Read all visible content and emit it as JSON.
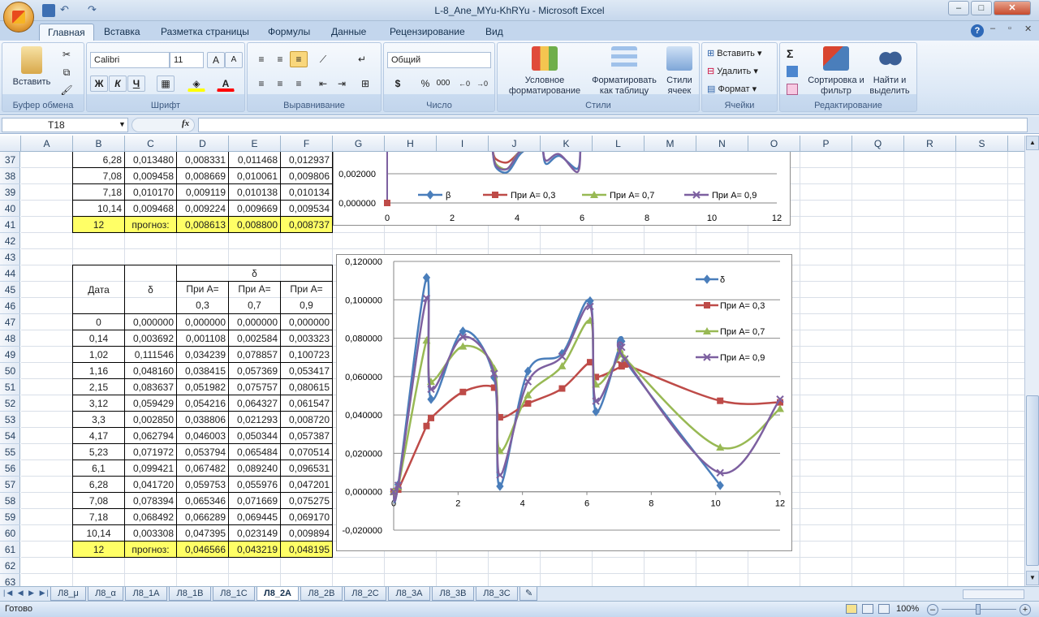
{
  "window": {
    "title": "L-8_Ane_MYu-KhRYu - Microsoft Excel"
  },
  "ribbon_tabs": [
    "Главная",
    "Вставка",
    "Разметка страницы",
    "Формулы",
    "Данные",
    "Рецензирование",
    "Вид"
  ],
  "ribbon": {
    "clipboard": {
      "paste": "Вставить",
      "label": "Буфер обмена"
    },
    "font": {
      "name": "Calibri",
      "size": "11",
      "label": "Шрифт",
      "bold": "Ж",
      "italic": "К",
      "underline": "Ч"
    },
    "alignment": {
      "label": "Выравнивание"
    },
    "number": {
      "format": "Общий",
      "label": "Число",
      "currency": "$",
      "percent": "%",
      "thousands": "000"
    },
    "styles": {
      "cond": "Условное форматирование",
      "table": "Форматировать как таблицу",
      "cell": "Стили ячеек",
      "label": "Стили"
    },
    "cells": {
      "insert": "Вставить",
      "delete": "Удалить",
      "format": "Формат",
      "label": "Ячейки"
    },
    "editing": {
      "sigma": "Σ",
      "sort": "Сортировка и фильтр",
      "find": "Найти и выделить",
      "label": "Редактирование"
    }
  },
  "formula_bar": {
    "name_box": "T18",
    "fx": "fx",
    "value": ""
  },
  "columns": [
    "A",
    "B",
    "C",
    "D",
    "E",
    "F",
    "G",
    "H",
    "I",
    "J",
    "K",
    "L",
    "M",
    "N",
    "O",
    "P",
    "Q",
    "R",
    "S"
  ],
  "rows": [
    "37",
    "38",
    "39",
    "40",
    "41",
    "42",
    "43",
    "44",
    "45",
    "46",
    "47",
    "48",
    "49",
    "50",
    "51",
    "52",
    "53",
    "54",
    "55",
    "56",
    "57",
    "58",
    "59",
    "60",
    "61",
    "62",
    "63"
  ],
  "top_table": [
    [
      "6,28",
      "0,013480",
      "0,008331",
      "0,011468",
      "0,012937"
    ],
    [
      "7,08",
      "0,009458",
      "0,008669",
      "0,010061",
      "0,009806"
    ],
    [
      "7,18",
      "0,010170",
      "0,009119",
      "0,010138",
      "0,010134"
    ],
    [
      "10,14",
      "0,009468",
      "0,009224",
      "0,009669",
      "0,009534"
    ]
  ],
  "top_forecast": [
    "12",
    "прогноз:",
    "0,008613",
    "0,008800",
    "0,008737"
  ],
  "table": {
    "h_date": "Дата",
    "h_delta": "δ",
    "h_group": "δ",
    "h_a1": "При А=",
    "h_a2": "При А=",
    "h_a3": "При А=",
    "h_v1": "0,3",
    "h_v2": "0,7",
    "h_v3": "0,9",
    "rows": [
      [
        "0",
        "0,000000",
        "0,000000",
        "0,000000",
        "0,000000"
      ],
      [
        "0,14",
        "0,003692",
        "0,001108",
        "0,002584",
        "0,003323"
      ],
      [
        "1,02",
        "0,111546",
        "0,034239",
        "0,078857",
        "0,100723"
      ],
      [
        "1,16",
        "0,048160",
        "0,038415",
        "0,057369",
        "0,053417"
      ],
      [
        "2,15",
        "0,083637",
        "0,051982",
        "0,075757",
        "0,080615"
      ],
      [
        "3,12",
        "0,059429",
        "0,054216",
        "0,064327",
        "0,061547"
      ],
      [
        "3,3",
        "0,002850",
        "0,038806",
        "0,021293",
        "0,008720"
      ],
      [
        "4,17",
        "0,062794",
        "0,046003",
        "0,050344",
        "0,057387"
      ],
      [
        "5,23",
        "0,071972",
        "0,053794",
        "0,065484",
        "0,070514"
      ],
      [
        "6,1",
        "0,099421",
        "0,067482",
        "0,089240",
        "0,096531"
      ],
      [
        "6,28",
        "0,041720",
        "0,059753",
        "0,055976",
        "0,047201"
      ],
      [
        "7,08",
        "0,078394",
        "0,065346",
        "0,071669",
        "0,075275"
      ],
      [
        "7,18",
        "0,068492",
        "0,066289",
        "0,069445",
        "0,069170"
      ],
      [
        "10,14",
        "0,003308",
        "0,047395",
        "0,023149",
        "0,009894"
      ]
    ],
    "forecast": [
      "12",
      "прогноз:",
      "0,046566",
      "0,043219",
      "0,048195"
    ]
  },
  "chart_data": [
    {
      "type": "line",
      "legend_position": "bottom",
      "x_ticks": [
        "0",
        "2",
        "4",
        "6",
        "8",
        "10",
        "12"
      ],
      "y_ticks": [
        "0,002000",
        "0,000000"
      ],
      "series": [
        {
          "name": "β",
          "color": "#4a7ebb"
        },
        {
          "name": "При А= 0,3",
          "color": "#be4b48"
        },
        {
          "name": "При А= 0,7",
          "color": "#98b954"
        },
        {
          "name": "При А= 0,9",
          "color": "#7d60a0"
        }
      ]
    },
    {
      "type": "line",
      "legend_position": "right",
      "xlim": [
        0,
        12
      ],
      "ylim": [
        -0.02,
        0.12
      ],
      "x_ticks": [
        "0",
        "2",
        "4",
        "6",
        "8",
        "10",
        "12"
      ],
      "y_ticks": [
        "0,120000",
        "0,100000",
        "0,080000",
        "0,060000",
        "0,040000",
        "0,020000",
        "0,000000",
        "-0,020000"
      ],
      "x": [
        0,
        0.14,
        1.02,
        1.16,
        2.15,
        3.12,
        3.3,
        4.17,
        5.23,
        6.1,
        6.28,
        7.08,
        7.18,
        10.14,
        12
      ],
      "series": [
        {
          "name": "δ",
          "color": "#4a7ebb",
          "values": [
            0,
            0.003692,
            0.111546,
            0.04816,
            0.083637,
            0.059429,
            0.00285,
            0.062794,
            0.071972,
            0.099421,
            0.04172,
            0.078394,
            0.068492,
            0.003308,
            null
          ]
        },
        {
          "name": "При А= 0,3",
          "color": "#be4b48",
          "values": [
            0,
            0.001108,
            0.034239,
            0.038415,
            0.051982,
            0.054216,
            0.038806,
            0.046003,
            0.053794,
            0.067482,
            0.059753,
            0.065346,
            0.066289,
            0.047395,
            0.046566
          ]
        },
        {
          "name": "При А= 0,7",
          "color": "#98b954",
          "values": [
            0,
            0.002584,
            0.078857,
            0.057369,
            0.075757,
            0.064327,
            0.021293,
            0.050344,
            0.065484,
            0.08924,
            0.055976,
            0.071669,
            0.069445,
            0.023149,
            0.043219
          ]
        },
        {
          "name": "При А= 0,9",
          "color": "#7d60a0",
          "values": [
            0,
            0.003323,
            0.100723,
            0.053417,
            0.080615,
            0.061547,
            0.00872,
            0.057387,
            0.070514,
            0.096531,
            0.047201,
            0.075275,
            0.06917,
            0.009894,
            0.048195
          ]
        }
      ]
    }
  ],
  "sheets": [
    "Л8_μ",
    "Л8_α",
    "Л8_1А",
    "Л8_1В",
    "Л8_1С",
    "Л8_2А",
    "Л8_2В",
    "Л8_2С",
    "Л8_3А",
    "Л8_3В",
    "Л8_3С"
  ],
  "active_sheet": "Л8_2А",
  "status": {
    "ready": "Готово",
    "zoom": "100%"
  }
}
